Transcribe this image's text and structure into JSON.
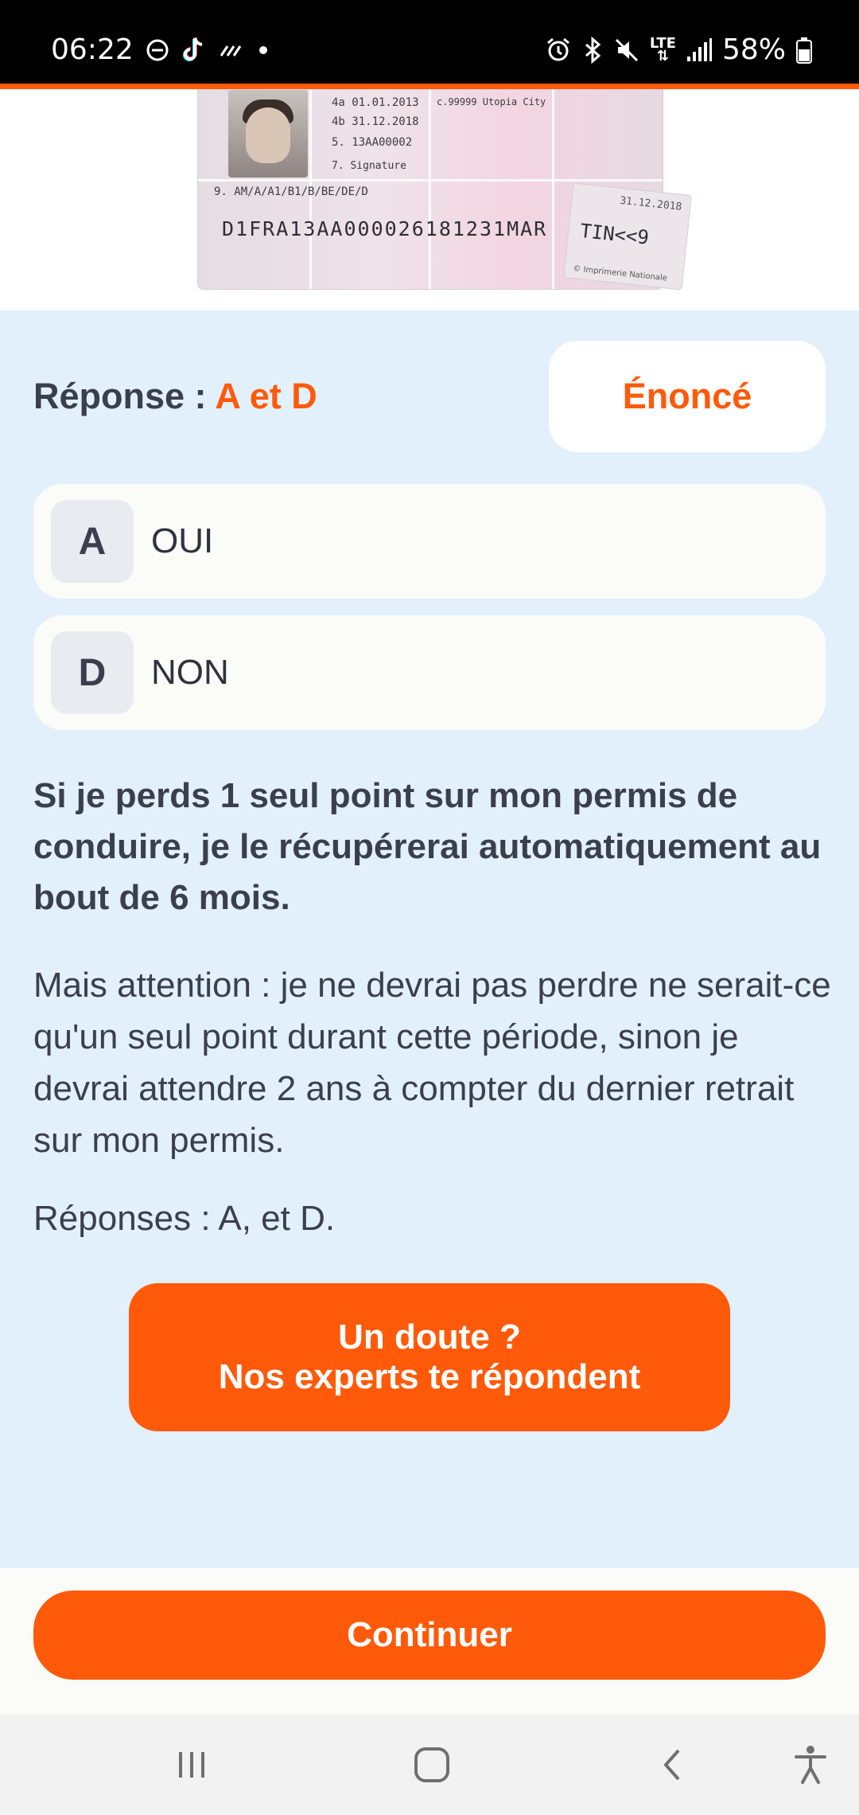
{
  "status_bar": {
    "time": "06:22",
    "network": "LTE",
    "battery": "58%",
    "icons_left": [
      "dnd-icon",
      "tiktok-icon",
      "missed-call-icon",
      "dot-icon"
    ],
    "icons_right": [
      "alarm-icon",
      "bluetooth-icon",
      "mute-icon",
      "lte-icon",
      "signal-icon",
      "battery-icon"
    ]
  },
  "license_image": {
    "date_issue": "4a 01.01.2013",
    "date_expiry": "4b 31.12.2018",
    "number": "5. 13AA00002",
    "city": "c.99999 Utopia City",
    "signature": "7. Signature",
    "categories": "9. AM/A/A1/B1/B/BE/DE/D",
    "mrz": "D1FRA13AA000026181231MAR",
    "stamp_text": "TIN<<9",
    "stamp_date": "31.12.2018",
    "stamp_footer": "© Imprimerie Nationale"
  },
  "answer": {
    "label": "Réponse : ",
    "value": "A et D",
    "statement_button": "Énoncé"
  },
  "options": [
    {
      "letter": "A",
      "text": "OUI"
    },
    {
      "letter": "D",
      "text": "NON"
    }
  ],
  "explanation": {
    "bold": "Si je perds 1 seul point sur mon permis de conduire, je le récupérerai automatiquement au bout de 6 mois.",
    "text": "Mais attention : je ne devrai pas perdre ne serait-ce qu'un seul point durant cette période, sinon je devrai attendre 2 ans à compter du dernier retrait sur mon permis.",
    "summary": "Réponses : A, et D."
  },
  "expert_button": {
    "line1": "Un doute ?",
    "line2": "Nos experts te répondent"
  },
  "continue_button": "Continuer",
  "colors": {
    "accent": "#ff5a0a",
    "background": "#e2f0fc",
    "text": "#3b3f4d"
  }
}
